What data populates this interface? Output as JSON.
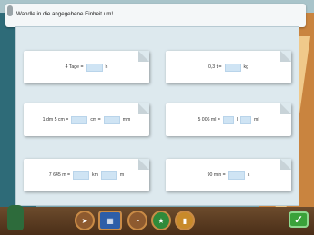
{
  "instruction": "Wandle in die angegebene Einheit um!",
  "cards": [
    {
      "parts": [
        "4 Tage =",
        "",
        "h"
      ]
    },
    {
      "parts": [
        "0,3 t =",
        "",
        "kg"
      ]
    },
    {
      "parts": [
        "1 dm 5 cm =",
        "",
        "cm =",
        "",
        "mm"
      ]
    },
    {
      "parts": [
        "5 006 ml =",
        "",
        "l",
        "",
        "ml"
      ]
    },
    {
      "parts": [
        "7 645 m =",
        "",
        "km",
        "",
        "m"
      ]
    },
    {
      "parts": [
        "90 min =",
        "",
        "s"
      ]
    }
  ],
  "toolbar": {
    "icons": [
      "arrow-icon",
      "calendar-icon",
      "clock-icon",
      "grade-icon",
      "folder-icon"
    ],
    "ok_icon": "check-icon"
  },
  "colors": {
    "answer_box": "#cfe4f4",
    "board": "#dde9ee",
    "toolbar": "#5a3a20",
    "ok": "#3aa23a"
  }
}
